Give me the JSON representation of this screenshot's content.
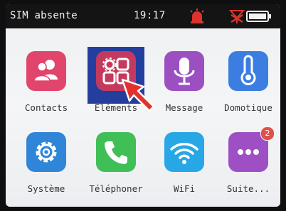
{
  "status_bar": {
    "sim_status": "SIM absente",
    "time": "19:17",
    "alarm_icon": "siren-icon",
    "signal_icon": "no-signal-icon",
    "battery_icon": "battery-icon"
  },
  "apps": [
    {
      "label": "Contacts",
      "icon": "contacts-icon",
      "color": "#e2456b"
    },
    {
      "label": "Eléments",
      "icon": "elements-grid-icon",
      "color": "#c43a5e"
    },
    {
      "label": "Message",
      "icon": "microphone-icon",
      "color": "#9b4fc1"
    },
    {
      "label": "Domotique",
      "icon": "thermometer-icon",
      "color": "#3b7de1"
    },
    {
      "label": "Système",
      "icon": "gear-icon",
      "color": "#2f86d8"
    },
    {
      "label": "Téléphoner",
      "icon": "phone-icon",
      "color": "#3fbf55"
    },
    {
      "label": "WiFi",
      "icon": "wifi-icon",
      "color": "#27a7e6"
    },
    {
      "label": "Suite...",
      "icon": "more-icon",
      "color": "#9f4fc4",
      "badge": "2"
    }
  ],
  "selected_app": "Eléments",
  "colors": {
    "highlight": "#243e9e",
    "pointer": "#e2322d"
  }
}
